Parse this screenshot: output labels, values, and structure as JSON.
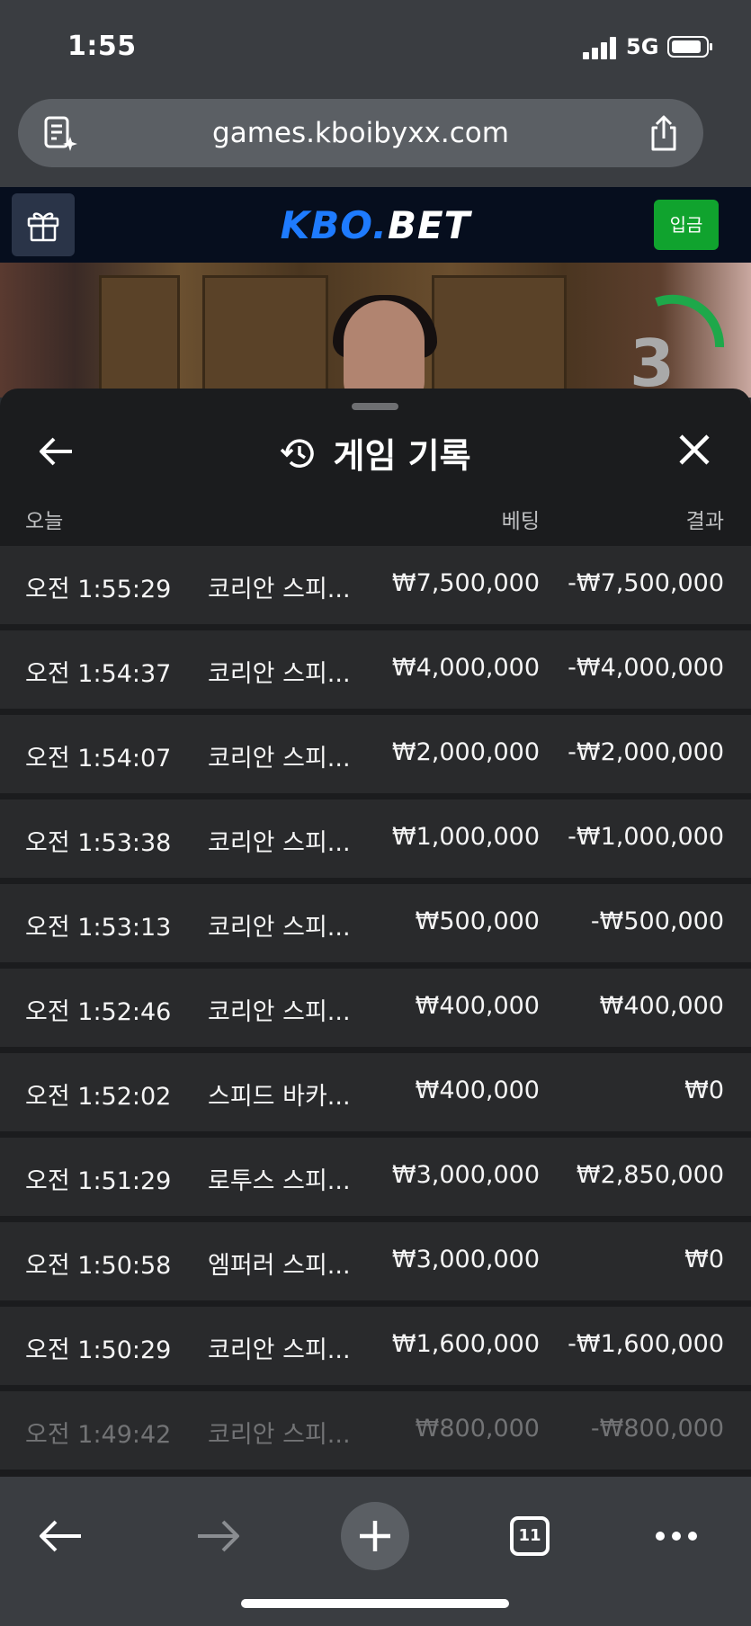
{
  "status_bar": {
    "time": "1:55",
    "network": "5G",
    "signal_bars": 4,
    "battery_level": 0.85
  },
  "browser": {
    "url": "games.kboibyxx.com",
    "open_tab_count": "11"
  },
  "site_header": {
    "logo_part1": "KBO.",
    "logo_part2": "BET",
    "deposit_label": "입금"
  },
  "video": {
    "countdown": "3"
  },
  "history_sheet": {
    "title": "게임 기록",
    "section_label": "오늘",
    "col_bet": "베팅",
    "col_result": "결과",
    "rows": [
      {
        "time": "오전 1:55:29",
        "game": "코리안 스피...",
        "bet": "₩7,500,000",
        "result": "-₩7,500,000"
      },
      {
        "time": "오전 1:54:37",
        "game": "코리안 스피...",
        "bet": "₩4,000,000",
        "result": "-₩4,000,000"
      },
      {
        "time": "오전 1:54:07",
        "game": "코리안 스피...",
        "bet": "₩2,000,000",
        "result": "-₩2,000,000"
      },
      {
        "time": "오전 1:53:38",
        "game": "코리안 스피...",
        "bet": "₩1,000,000",
        "result": "-₩1,000,000"
      },
      {
        "time": "오전 1:53:13",
        "game": "코리안 스피...",
        "bet": "₩500,000",
        "result": "-₩500,000"
      },
      {
        "time": "오전 1:52:46",
        "game": "코리안 스피...",
        "bet": "₩400,000",
        "result": "₩400,000"
      },
      {
        "time": "오전 1:52:02",
        "game": "스피드 바카...",
        "bet": "₩400,000",
        "result": "₩0"
      },
      {
        "time": "오전 1:51:29",
        "game": "로투스 스피...",
        "bet": "₩3,000,000",
        "result": "₩2,850,000"
      },
      {
        "time": "오전 1:50:58",
        "game": "엠퍼러 스피...",
        "bet": "₩3,000,000",
        "result": "₩0"
      },
      {
        "time": "오전 1:50:29",
        "game": "코리안 스피...",
        "bet": "₩1,600,000",
        "result": "-₩1,600,000"
      },
      {
        "time": "오전 1:49:42",
        "game": "코리안 스피...",
        "bet": "₩800,000",
        "result": "-₩800,000"
      }
    ]
  },
  "colors": {
    "accent_blue": "#1e7bff",
    "deposit_green": "#10a32e",
    "sheet_bg": "#1b1c1e",
    "row_bg": "#292a2c"
  }
}
